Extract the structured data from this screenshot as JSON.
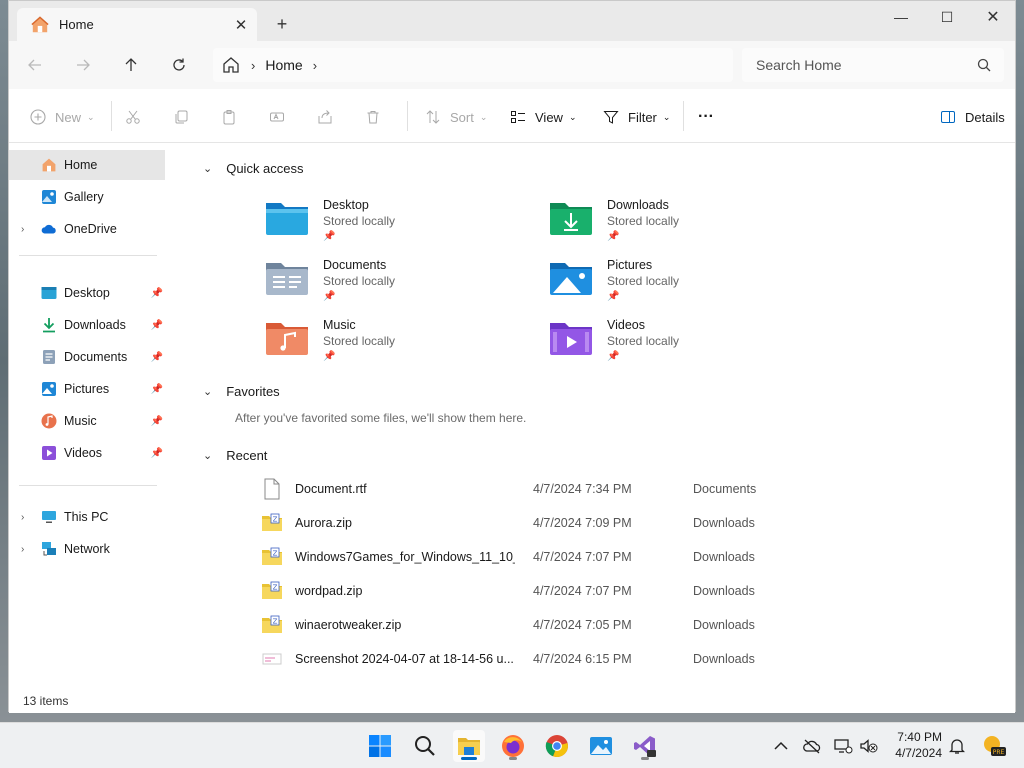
{
  "window": {
    "tab_title": "Home",
    "tab_close": "✕",
    "new_tab": "+",
    "minimize": "—",
    "maximize": "☐",
    "close": "✕"
  },
  "navbar": {
    "breadcrumb": [
      "Home"
    ],
    "search_placeholder": "Search Home"
  },
  "commandbar": {
    "new_label": "New",
    "sort_label": "Sort",
    "view_label": "View",
    "filter_label": "Filter",
    "more_label": "···",
    "details_label": "Details"
  },
  "sidebar": {
    "top": [
      {
        "label": "Home",
        "icon": "home-icon"
      },
      {
        "label": "Gallery",
        "icon": "gallery-icon"
      },
      {
        "label": "OneDrive",
        "icon": "cloud-icon"
      }
    ],
    "pinned": [
      {
        "label": "Desktop",
        "icon": "desktop-folder-icon"
      },
      {
        "label": "Downloads",
        "icon": "download-icon"
      },
      {
        "label": "Documents",
        "icon": "documents-icon"
      },
      {
        "label": "Pictures",
        "icon": "pictures-icon"
      },
      {
        "label": "Music",
        "icon": "music-icon"
      },
      {
        "label": "Videos",
        "icon": "videos-icon"
      }
    ],
    "bottom": [
      {
        "label": "This PC",
        "icon": "computer-icon"
      },
      {
        "label": "Network",
        "icon": "network-icon"
      }
    ]
  },
  "quick_access": {
    "heading": "Quick access",
    "items": [
      {
        "name": "Desktop",
        "sub": "Stored locally"
      },
      {
        "name": "Downloads",
        "sub": "Stored locally"
      },
      {
        "name": "Documents",
        "sub": "Stored locally"
      },
      {
        "name": "Pictures",
        "sub": "Stored locally"
      },
      {
        "name": "Music",
        "sub": "Stored locally"
      },
      {
        "name": "Videos",
        "sub": "Stored locally"
      }
    ]
  },
  "favorites": {
    "heading": "Favorites",
    "empty_text": "After you've favorited some files, we'll show them here."
  },
  "recent": {
    "heading": "Recent",
    "rows": [
      {
        "name": "Document.rtf",
        "date": "4/7/2024 7:34 PM",
        "location": "Documents"
      },
      {
        "name": "Aurora.zip",
        "date": "4/7/2024 7:09 PM",
        "location": "Downloads"
      },
      {
        "name": "Windows7Games_for_Windows_11_10_...",
        "date": "4/7/2024 7:07 PM",
        "location": "Downloads"
      },
      {
        "name": "wordpad.zip",
        "date": "4/7/2024 7:07 PM",
        "location": "Downloads"
      },
      {
        "name": "winaerotweaker.zip",
        "date": "4/7/2024 7:05 PM",
        "location": "Downloads"
      },
      {
        "name": "Screenshot 2024-04-07 at 18-14-56 u...",
        "date": "4/7/2024 6:15 PM",
        "location": "Downloads"
      }
    ]
  },
  "status": {
    "item_count": "13 items"
  },
  "taskbar": {
    "time": "7:40 PM",
    "date": "4/7/2024"
  },
  "colors": {
    "accent": "#0067c0",
    "folder_yellow": "#f3c93c",
    "selected_bg": "#e6e6e6"
  }
}
